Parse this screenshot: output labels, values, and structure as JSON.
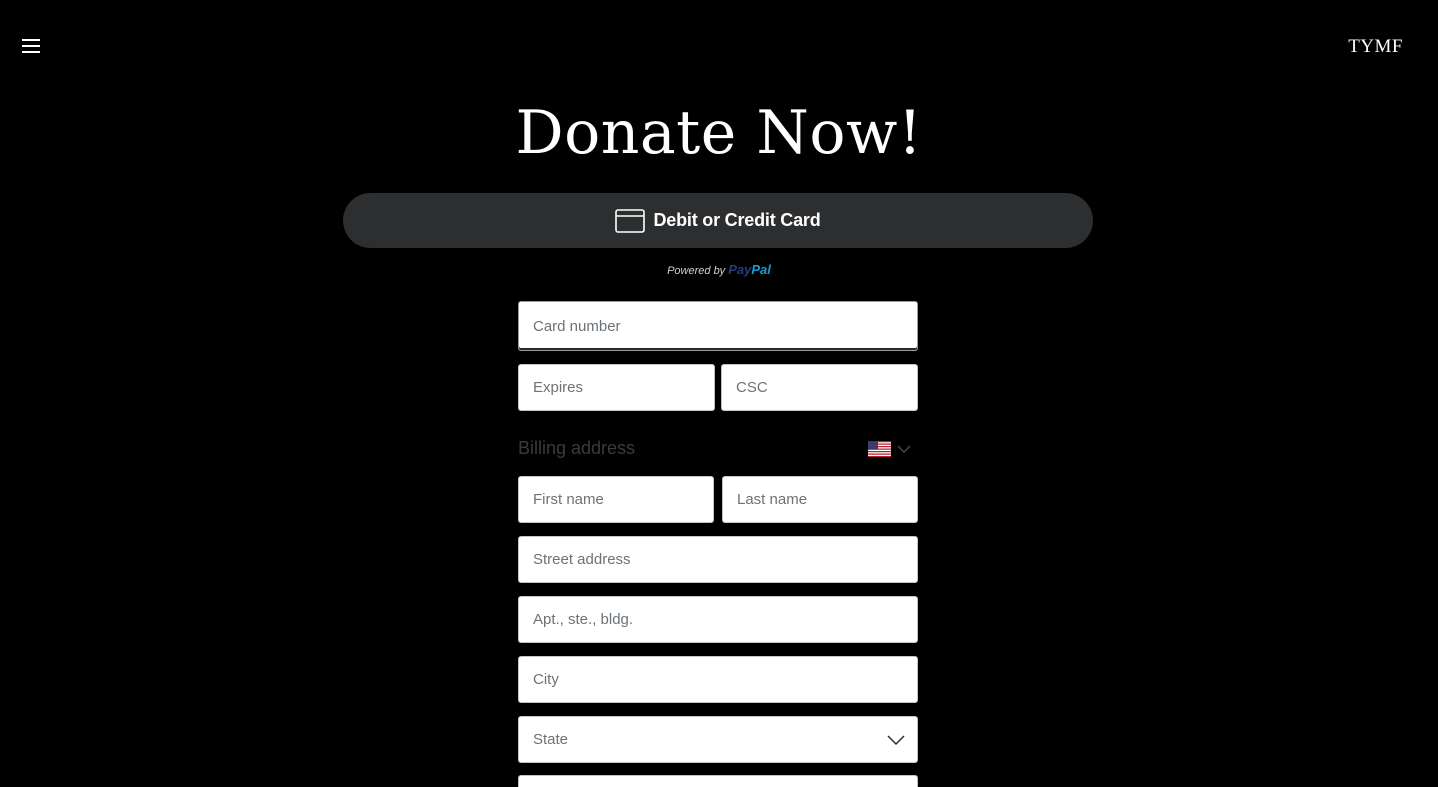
{
  "header": {
    "brand": "TYMF"
  },
  "title": "Donate Now!",
  "payment": {
    "card_button_label": "Debit or Credit Card",
    "powered_by": "Powered by",
    "paypal_part1": "Pay",
    "paypal_part2": "Pal"
  },
  "form": {
    "card_number_placeholder": "Card number",
    "expires_placeholder": "Expires",
    "csc_placeholder": "CSC",
    "billing_label": "Billing address",
    "first_name_placeholder": "First name",
    "last_name_placeholder": "Last name",
    "street_placeholder": "Street address",
    "apt_placeholder": "Apt., ste., bldg.",
    "city_placeholder": "City",
    "state_placeholder": "State"
  },
  "icons": {
    "menu": "hamburger-menu-icon",
    "card": "credit-card-icon",
    "flag": "us-flag-icon",
    "chevron": "chevron-down-icon"
  },
  "colors": {
    "background": "#000000",
    "button": "#2c2e2f",
    "paypal_dark": "#253b80",
    "paypal_light": "#179bd7"
  }
}
